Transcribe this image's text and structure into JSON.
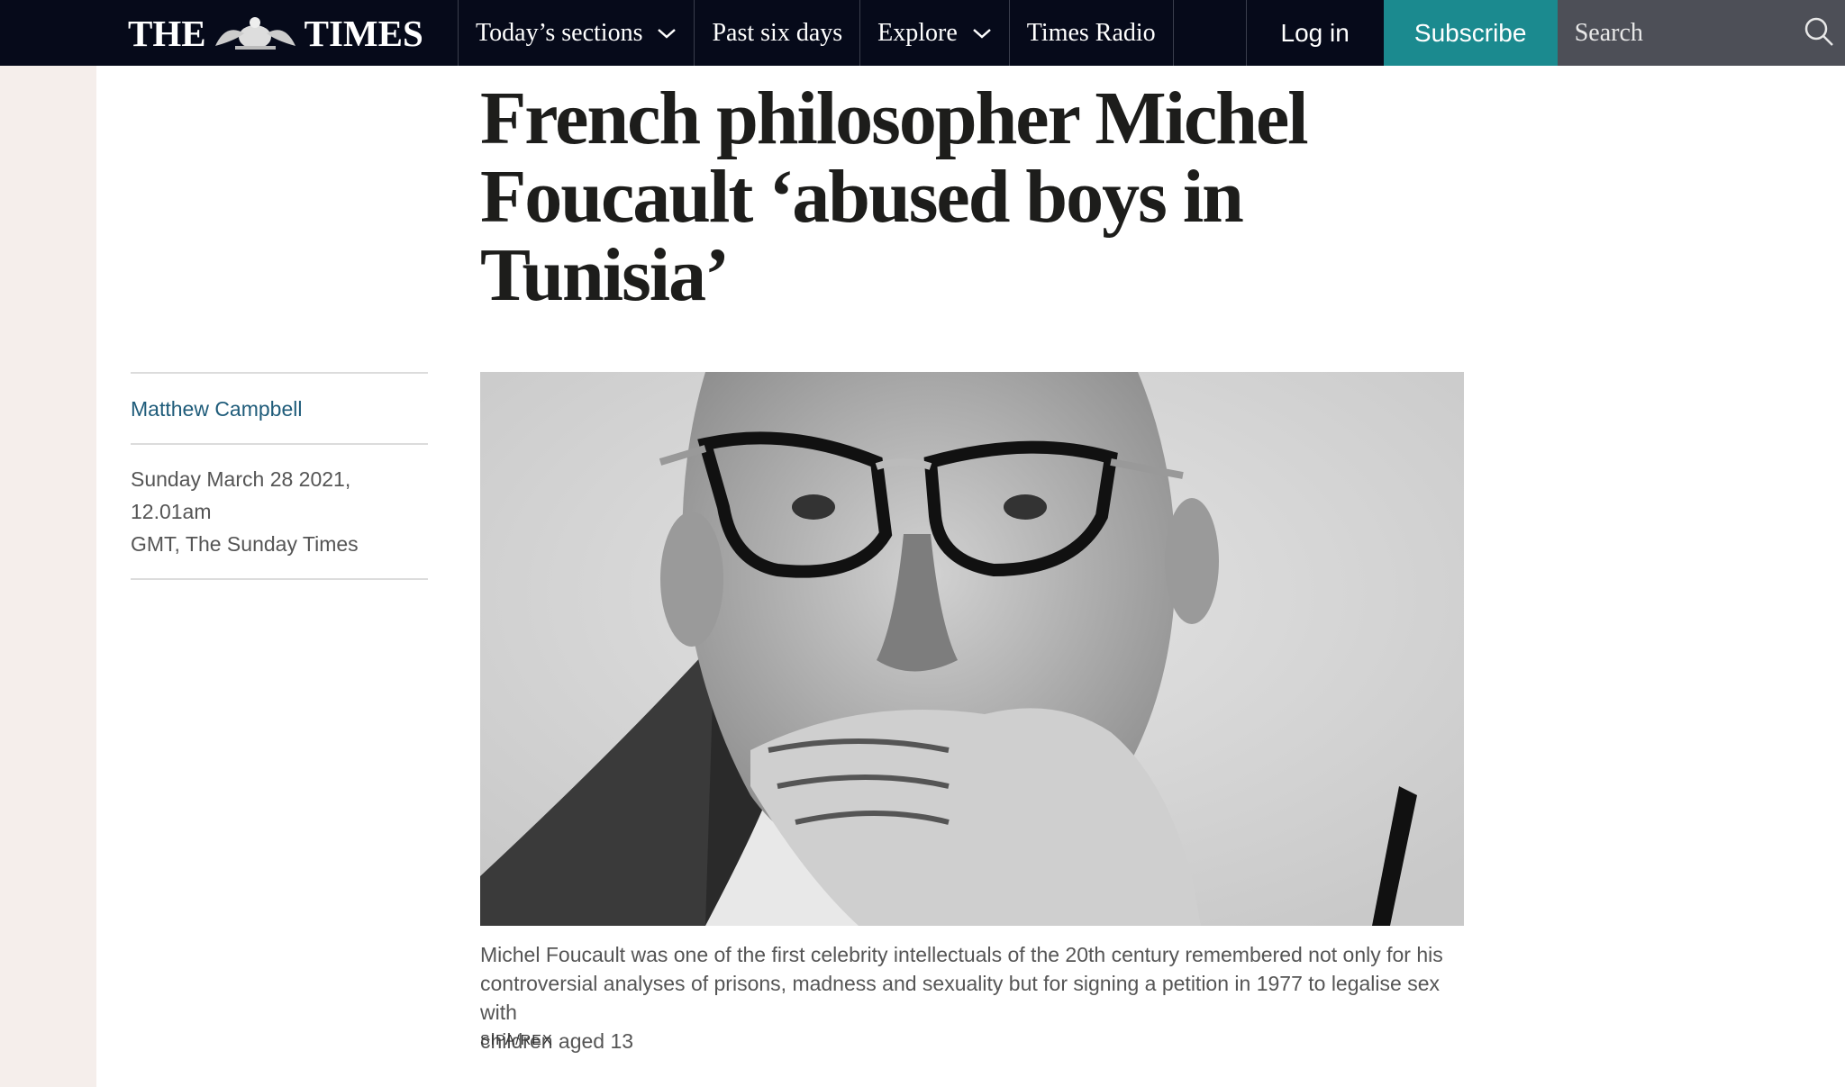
{
  "header": {
    "logo_left": "THE",
    "logo_right": "TIMES",
    "nav": [
      {
        "label": "Today’s sections",
        "has_dropdown": true
      },
      {
        "label": "Past six days",
        "has_dropdown": false
      },
      {
        "label": "Explore",
        "has_dropdown": true
      },
      {
        "label": "Times Radio",
        "has_dropdown": false
      }
    ],
    "login_label": "Log in",
    "subscribe_label": "Subscribe",
    "search_placeholder": "Search",
    "search_icon": "search-icon",
    "subscribe_color": "#1b8a8f",
    "bar_color": "#060a1a"
  },
  "article": {
    "headline_lines": [
      "French philosopher Michel",
      "Foucault ‘abused boys in",
      "Tunisia’"
    ],
    "author": "Matthew Campbell",
    "dateline_line1": "Sunday March 28 2021, 12.01am",
    "dateline_line2": "GMT, The Sunday Times",
    "image_alt": "Michel Foucault",
    "caption_lines": [
      "Michel Foucault was one of the first celebrity intellectuals of the 20th century remembered not only for his",
      "controversial analyses of prisons, madness and sexuality but for signing a petition in 1977 to legalise sex with",
      "children aged 13"
    ],
    "credit": "SIPA/REX"
  }
}
